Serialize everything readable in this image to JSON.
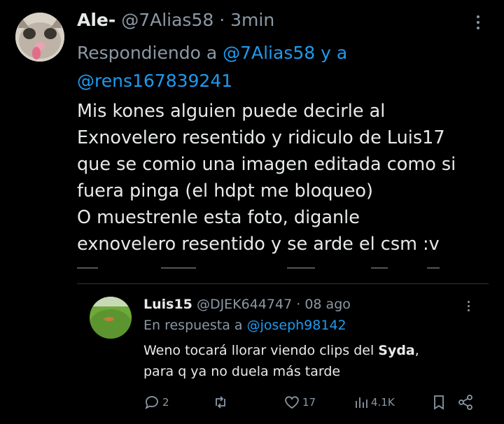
{
  "main_tweet": {
    "author_name": "Ale-",
    "author_handle": "@7Alias58",
    "separator": "·",
    "time": "3min",
    "reply_prefix": "Respondiendo a ",
    "reply_mention_1": "@7Alias58 y a",
    "reply_mention_2": "@rens167839241",
    "text_lines": [
      "Mis kones alguien puede decirle al",
      "Exnovelero resentido y ridiculo de Luis17",
      "que se comio una imagen editada como si",
      "fuera pinga (el hdpt me bloqueo)",
      "O muestrenle esta foto, diganle",
      "exnovelero resentido y se arde el csm :v"
    ]
  },
  "quoted_tweet": {
    "author_name": "Luis15",
    "author_handle": "@DJEK644747",
    "separator": "·",
    "time": "08 ago",
    "reply_prefix": "En respuesta a ",
    "reply_mention": "@joseph98142",
    "text_line_1_pre": "Weno tocará llorar viendo clips del ",
    "text_line_1_bold": "Syda",
    "text_line_1_post": ",",
    "text_line_2": "para q ya no duela más tarde",
    "actions": {
      "replies": "2",
      "retweets": "",
      "likes": "17",
      "views": "4.1K"
    }
  },
  "colors": {
    "background": "#000000",
    "text": "#e7e9ea",
    "muted": "#8b98a5",
    "link": "#1d9bf0",
    "divider": "#2f3336"
  }
}
